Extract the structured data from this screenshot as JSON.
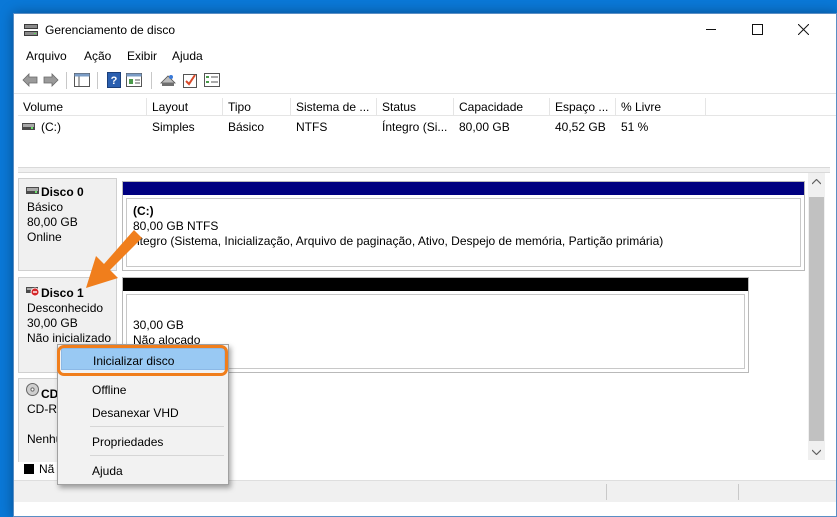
{
  "window": {
    "title": "Gerenciamento de disco"
  },
  "menu": [
    "Arquivo",
    "Ação",
    "Exibir",
    "Ajuda"
  ],
  "volume_list": {
    "columns": [
      "Volume",
      "Layout",
      "Tipo",
      "Sistema de ...",
      "Status",
      "Capacidade",
      "Espaço ...",
      "% Livre"
    ],
    "rows": [
      {
        "volume": "(C:)",
        "layout": "Simples",
        "tipo": "Básico",
        "sistema": "NTFS",
        "status": "Íntegro (Si...",
        "capacidade": "80,00 GB",
        "espaco": "40,52 GB",
        "livre": "51 %"
      }
    ]
  },
  "disks": [
    {
      "name": "Disco 0",
      "type": "Básico",
      "size": "80,00 GB",
      "state": "Online",
      "partition": {
        "label": "(C:)",
        "size_fs": "80,00 GB NTFS",
        "status": "Íntegro (Sistema, Inicialização, Arquivo de paginação, Ativo, Despejo de memória, Partição primária)",
        "status_visible": "ntegro (Sistema, Inicialização, Arquivo de paginação, Ativo, Despejo de memória, Partição primária)"
      }
    },
    {
      "name": "Disco 1",
      "type": "Desconhecido",
      "size": "30,00 GB",
      "state": "Não inicializado",
      "partition": {
        "size": "30,00 GB",
        "status": "Não alocado"
      }
    },
    {
      "name": "CD",
      "type": "CD-RO",
      "state": "Nenhu"
    }
  ],
  "legend": {
    "label": "Nã"
  },
  "context_menu": {
    "items": [
      "Inicializar disco",
      "Offline",
      "Desanexar VHD",
      "Propriedades",
      "Ajuda"
    ],
    "highlighted": "Inicializar disco"
  },
  "colors": {
    "primary_partition_bar": "#000080",
    "unallocated_bar": "#000000",
    "highlight": "#99c9f3",
    "callout": "#f07e1c",
    "desktop": "#0a78d7"
  }
}
